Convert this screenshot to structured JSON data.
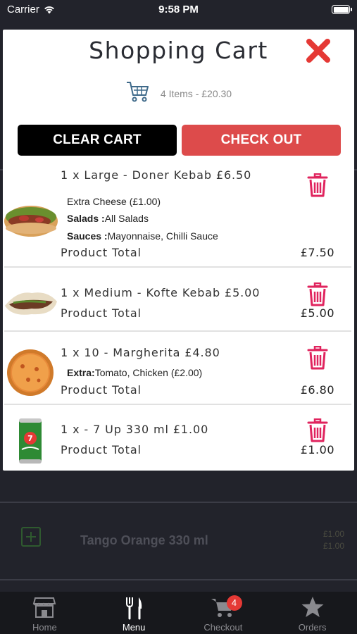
{
  "status_bar": {
    "carrier": "Carrier",
    "time": "9:58 PM"
  },
  "cart": {
    "title": "Shopping Cart",
    "summary": "4 Items - £20.30",
    "clear_label": "CLEAR CART",
    "checkout_label": "CHECK OUT",
    "items": [
      {
        "title": "1 x Large - Doner Kebab £6.50",
        "options": [
          {
            "label": "",
            "value": "Extra Cheese (£1.00)"
          },
          {
            "label": "Salads :",
            "value": "All Salads"
          },
          {
            "label": "Sauces :",
            "value": "Mayonnaise, Chilli Sauce"
          }
        ],
        "total_label": "Product Total",
        "total": "£7.50"
      },
      {
        "title": "1 x Medium - Kofte Kebab £5.00",
        "options": [],
        "total_label": "Product Total",
        "total": "£5.00"
      },
      {
        "title": "1 x 10 - Margherita £4.80",
        "options": [
          {
            "label": "Extra:",
            "value": "Tomato, Chicken (£2.00)"
          }
        ],
        "total_label": "Product Total",
        "total": "£6.80"
      },
      {
        "title": "1 x - 7 Up 330 ml £1.00",
        "options": [],
        "total_label": "Product Total",
        "total": "£1.00"
      }
    ]
  },
  "background_menu": {
    "item_name": "Tango Orange 330 ml",
    "price_1": "£1.00",
    "price_2": "£1.00"
  },
  "tabs": [
    {
      "label": "Home",
      "icon": "store-icon"
    },
    {
      "label": "Menu",
      "icon": "fork-knife-icon"
    },
    {
      "label": "Checkout",
      "icon": "cart-icon",
      "badge": "4"
    },
    {
      "label": "Orders",
      "icon": "star-icon"
    }
  ],
  "colors": {
    "accent_red": "#dd4b4b",
    "trash_pink": "#e0245e",
    "close_red": "#e53935"
  }
}
